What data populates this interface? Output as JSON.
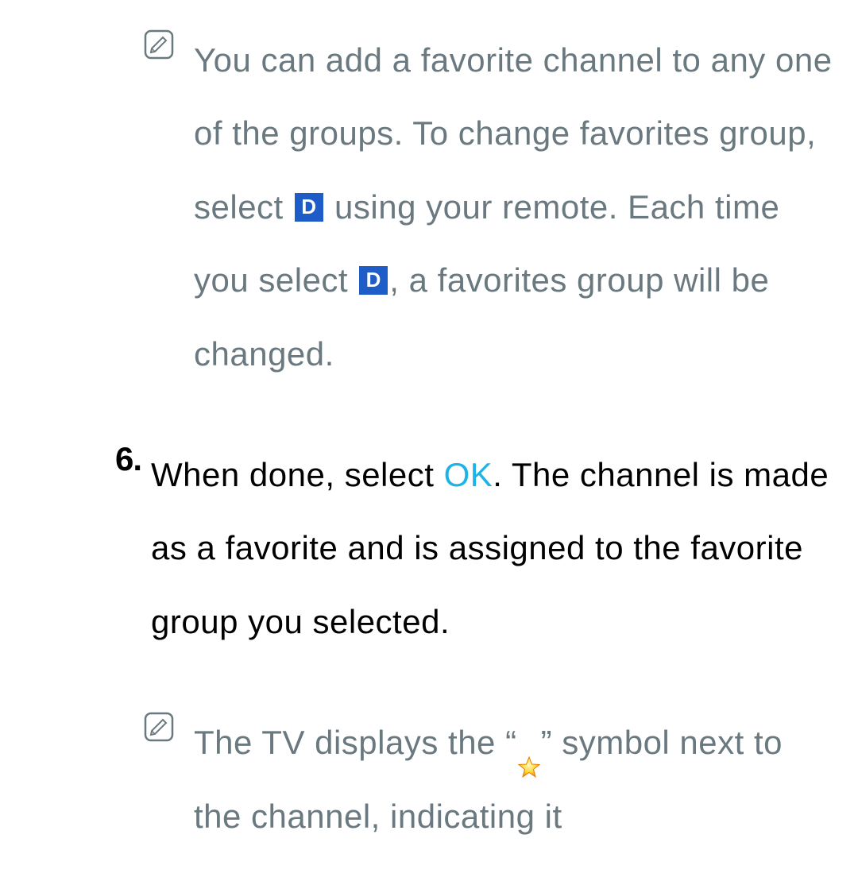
{
  "note1": {
    "text_part1": "You can add a favorite channel to any one of the groups. To change favorites group, select ",
    "d_label": "D",
    "text_part2": " using your remote. Each time you select ",
    "text_part3": ", a favorites group will be changed."
  },
  "step6": {
    "number": "6.",
    "text_part1": "When done, select ",
    "ok_label": "OK",
    "text_part2": ". The channel is made as a favorite and is assigned to the favorite group you selected."
  },
  "note2": {
    "text_part1": "The TV displays the “",
    "text_part2": "” symbol next to the channel, indicating it"
  }
}
